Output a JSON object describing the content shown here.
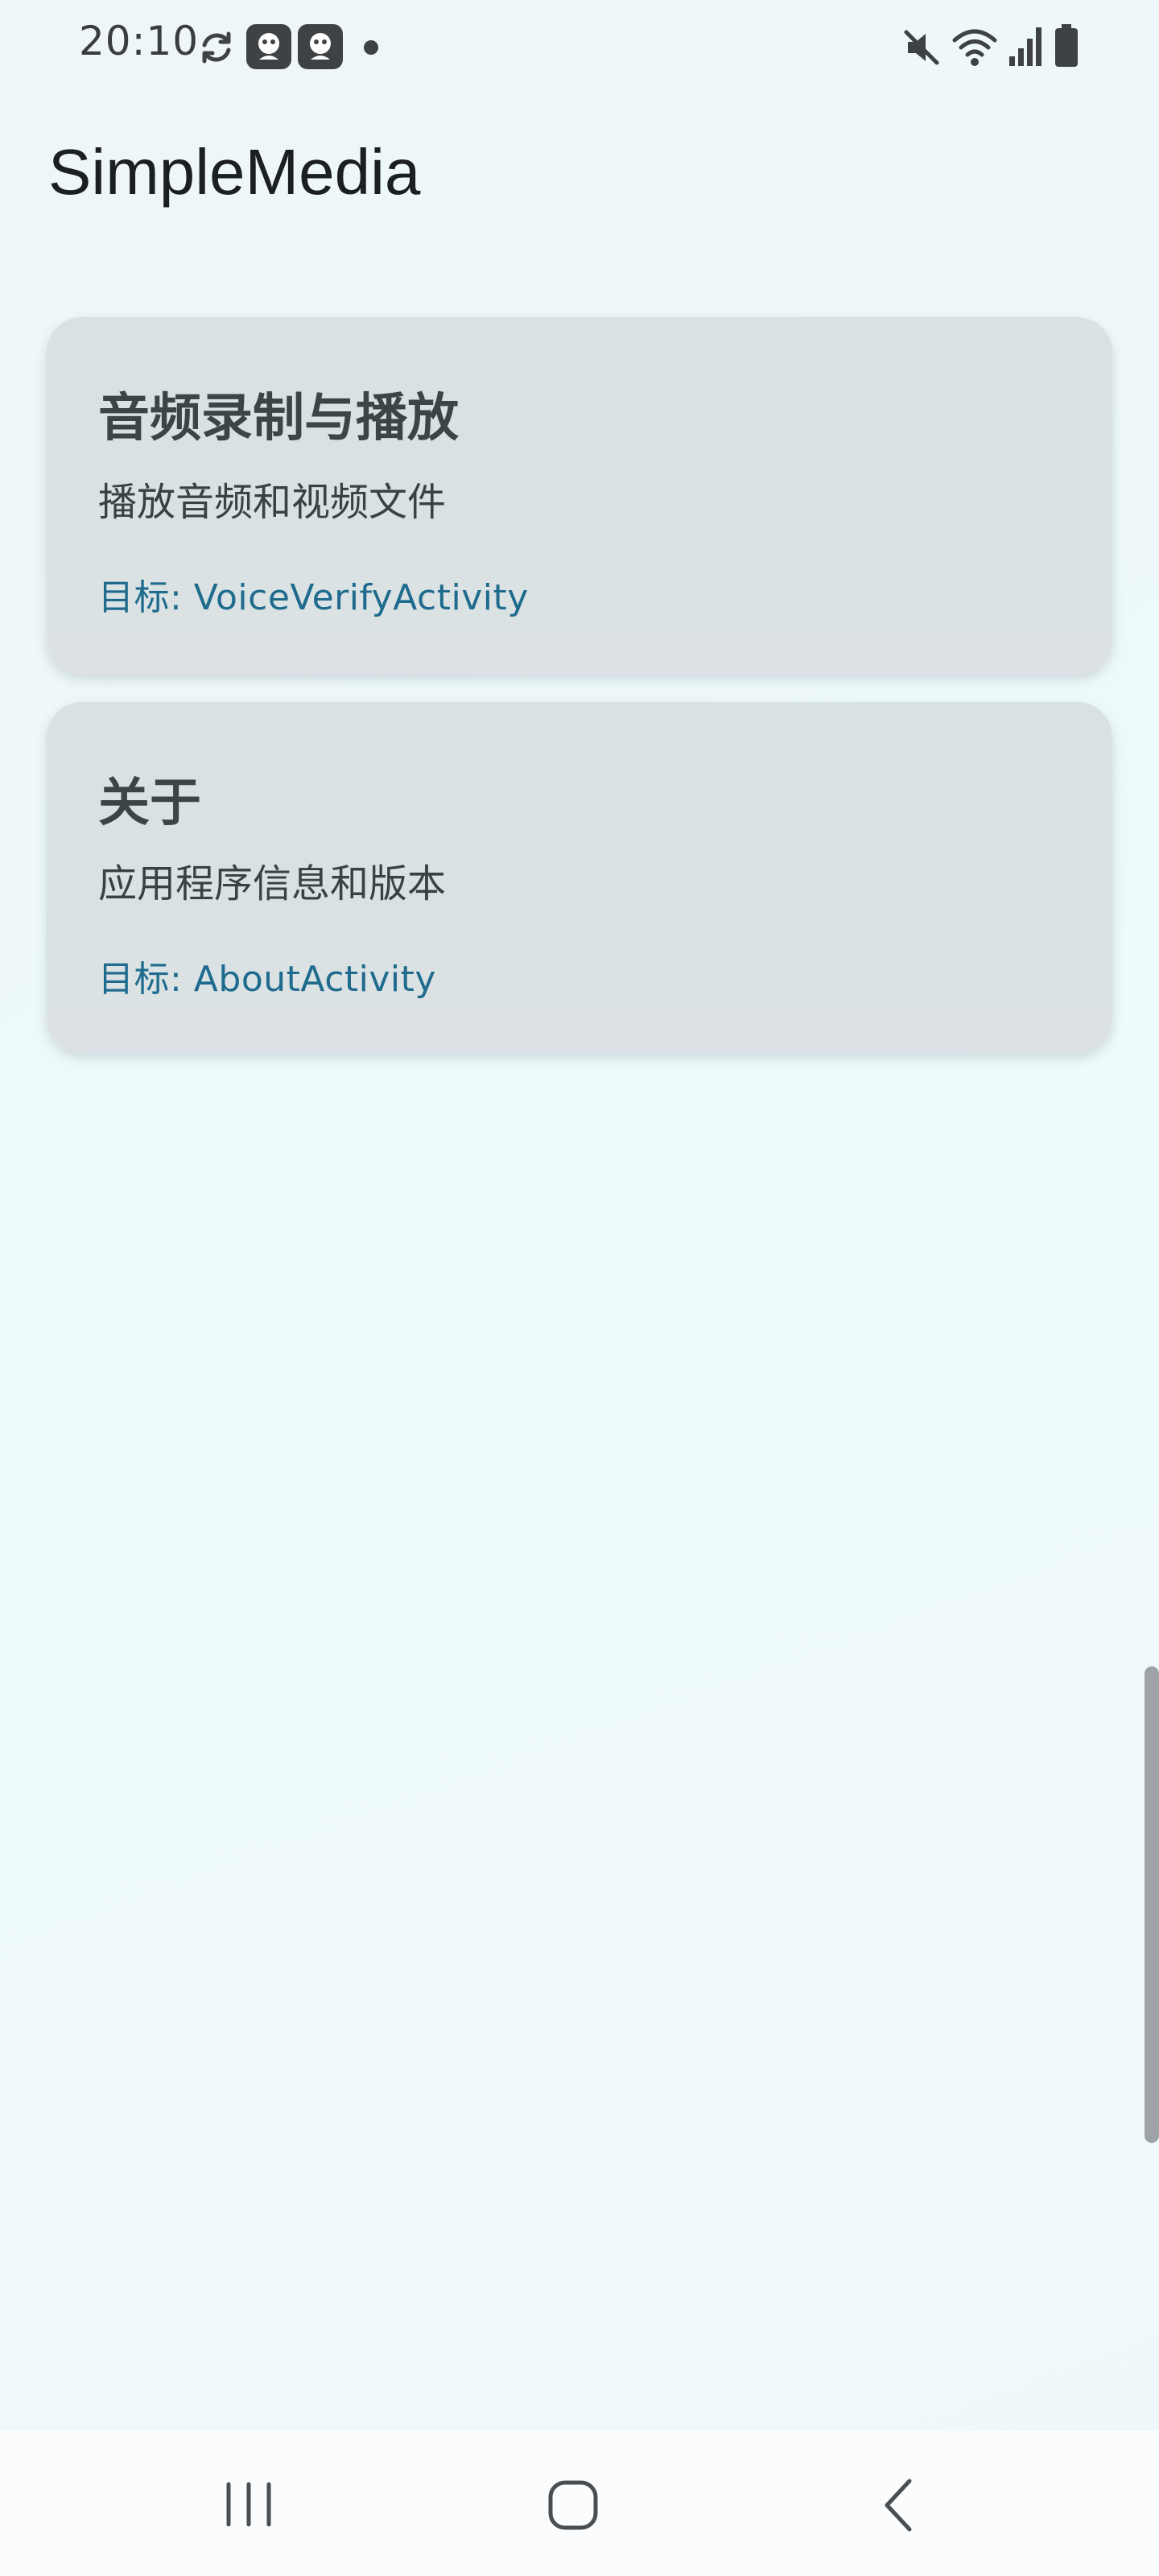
{
  "status_bar": {
    "time": "20:10",
    "icons": [
      "sync-icon",
      "app-notification-icon",
      "app-notification-icon",
      "notification-dot",
      "mute-icon",
      "wifi-icon",
      "signal-icon",
      "battery-icon"
    ]
  },
  "app": {
    "title": "SimpleMedia"
  },
  "cards": [
    {
      "title": "音频录制与播放",
      "description": "播放音频和视频文件",
      "target": "目标: VoiceVerifyActivity"
    },
    {
      "title": "关于",
      "description": "应用程序信息和版本",
      "target": "目标: AboutActivity"
    }
  ],
  "colors": {
    "card_background": "#d8e2e3",
    "target_text": "#1f6b8e",
    "page_background": "#eef6f8"
  },
  "nav_bar": {
    "icons": [
      "recents-icon",
      "home-icon",
      "back-icon"
    ]
  }
}
